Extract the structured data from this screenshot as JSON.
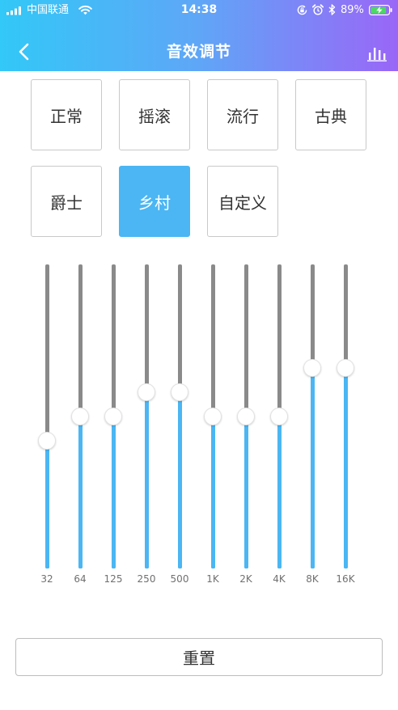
{
  "status_bar": {
    "carrier": "中国联通",
    "time": "14:38",
    "battery_percent": "89%",
    "battery_level": 0.89,
    "icons": [
      "signal-icon",
      "wifi-icon",
      "rotation-lock-icon",
      "alarm-icon",
      "bluetooth-icon",
      "battery-charging-icon"
    ]
  },
  "header": {
    "title": "音效调节",
    "left_icon": "chevron-left-icon",
    "right_icon": "equalizer-icon"
  },
  "presets": [
    {
      "label": "正常",
      "selected": false
    },
    {
      "label": "摇滚",
      "selected": false
    },
    {
      "label": "流行",
      "selected": false
    },
    {
      "label": "古典",
      "selected": false
    },
    {
      "label": "爵士",
      "selected": false
    },
    {
      "label": "乡村",
      "selected": true
    },
    {
      "label": "自定义",
      "selected": false
    }
  ],
  "equalizer": {
    "bands": [
      {
        "label": "32",
        "level": 0.42
      },
      {
        "label": "64",
        "level": 0.5
      },
      {
        "label": "125",
        "level": 0.5
      },
      {
        "label": "250",
        "level": 0.58
      },
      {
        "label": "500",
        "level": 0.58
      },
      {
        "label": "1K",
        "level": 0.5
      },
      {
        "label": "2K",
        "level": 0.5
      },
      {
        "label": "4K",
        "level": 0.5
      },
      {
        "label": "8K",
        "level": 0.66
      },
      {
        "label": "16K",
        "level": 0.66
      }
    ]
  },
  "reset_button": {
    "label": "重置"
  },
  "colors": {
    "header_gradient": [
      "#32C8F7",
      "#5FA6F7",
      "#9A66F7"
    ],
    "accent": "#4BB6F3",
    "track": "#8A8A8A",
    "battery_fill": "#4CD964"
  }
}
